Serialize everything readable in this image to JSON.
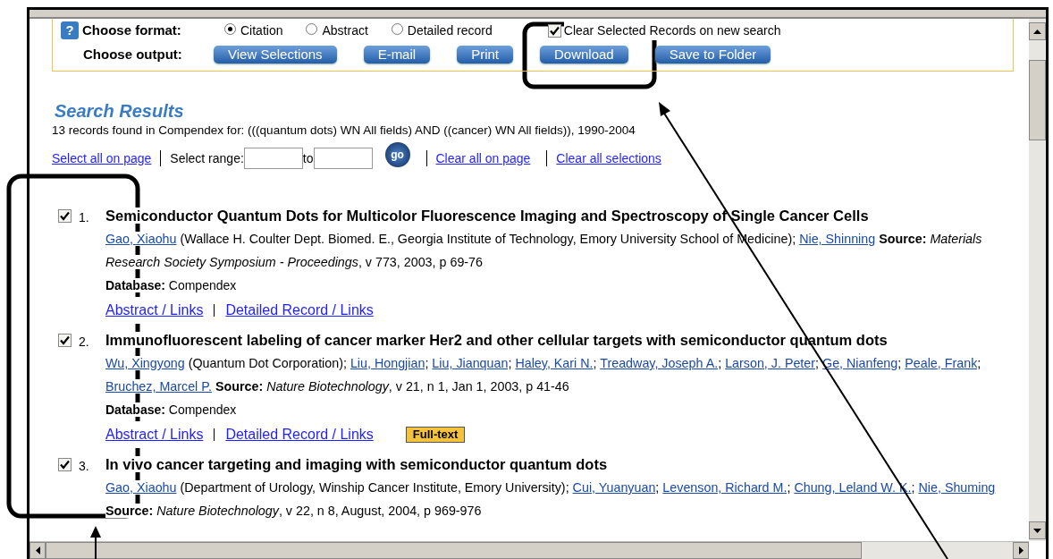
{
  "format": {
    "help": "?",
    "label": "Choose format:",
    "options": [
      {
        "label": "Citation",
        "selected": true
      },
      {
        "label": "Abstract",
        "selected": false
      },
      {
        "label": "Detailed record",
        "selected": false
      }
    ],
    "clear_selected": {
      "label": "Clear Selected Records on new search",
      "checked": true
    }
  },
  "output": {
    "label": "Choose output:",
    "buttons": [
      "View Selections",
      "E-mail",
      "Print",
      "Download",
      "Save to Folder"
    ]
  },
  "heading": "Search Results",
  "summary": "13 records found in Compendex for: (((quantum dots) WN All fields) AND ((cancer) WN All fields)), 1990-2004",
  "range": {
    "select_all": "Select all on page",
    "label": "Select range:",
    "to": "to",
    "go": "go",
    "clear_page": "Clear all on page",
    "clear_all": "Clear all selections"
  },
  "records": [
    {
      "checked": true,
      "number": "1.",
      "title": "Semiconductor Quantum Dots for Multicolor Fluorescence Imaging and Spectroscopy of Single Cancer Cells",
      "authors": [
        {
          "name": "Gao, Xiaohu",
          "affiliation": "(Wallace H. Coulter Dept. Biomed. E., Georgia Institute of Technology, Emory University School of Medicine)",
          "separator": ";"
        },
        {
          "name": "Nie, Shinning"
        }
      ],
      "source_label": "Source:",
      "source_title": "Materials Research Society Symposium - Proceedings",
      "source_details": ", v 773, 2003, p 69-76",
      "database_label": "Database:",
      "database": "Compendex",
      "links": [
        "Abstract / Links",
        "Detailed Record / Links"
      ]
    },
    {
      "checked": true,
      "number": "2.",
      "title": "Immunofluorescent labeling of cancer marker Her2 and other cellular targets with semiconductor quantum dots",
      "authors": [
        {
          "name": "Wu, Xingyong",
          "affiliation": "(Quantum Dot Corporation)",
          "separator": ";"
        },
        {
          "name": "Liu, Hongjian",
          "separator": ";"
        },
        {
          "name": "Liu, Jianquan",
          "separator": ";"
        },
        {
          "name": "Haley, Kari N.",
          "separator": ";"
        },
        {
          "name": "Treadway, Joseph A.",
          "separator": ";"
        },
        {
          "name": "Larson, J. Peter",
          "separator": ";"
        },
        {
          "name": "Ge, Nianfeng",
          "separator": ";"
        },
        {
          "name": "Peale, Frank",
          "separator": ";"
        },
        {
          "name": "Bruchez, Marcel P."
        }
      ],
      "source_label": "Source:",
      "source_title": "Nature Biotechnology",
      "source_details": ", v 21, n 1, Jan 1, 2003, p 41-46",
      "database_label": "Database:",
      "database": "Compendex",
      "links": [
        "Abstract / Links",
        "Detailed Record / Links"
      ],
      "badge": "Full-text"
    },
    {
      "checked": true,
      "number": "3.",
      "title": "In vivo cancer targeting and imaging with semiconductor quantum dots",
      "authors": [
        {
          "name": "Gao, Xiaohu",
          "affiliation": "(Department of Urology, Winship Cancer Institute, Emory University)",
          "separator": ";"
        },
        {
          "name": "Cui, Yuanyuan",
          "separator": ";"
        },
        {
          "name": "Levenson, Richard M.",
          "separator": ";"
        },
        {
          "name": "Chung, Leland W. K.",
          "separator": ";"
        },
        {
          "name": "Nie, Shuming"
        }
      ],
      "source_label": "Source:",
      "source_title": "Nature Biotechnology",
      "source_details": ", v 22, n 8, August, 2004, p 969-976"
    }
  ]
}
